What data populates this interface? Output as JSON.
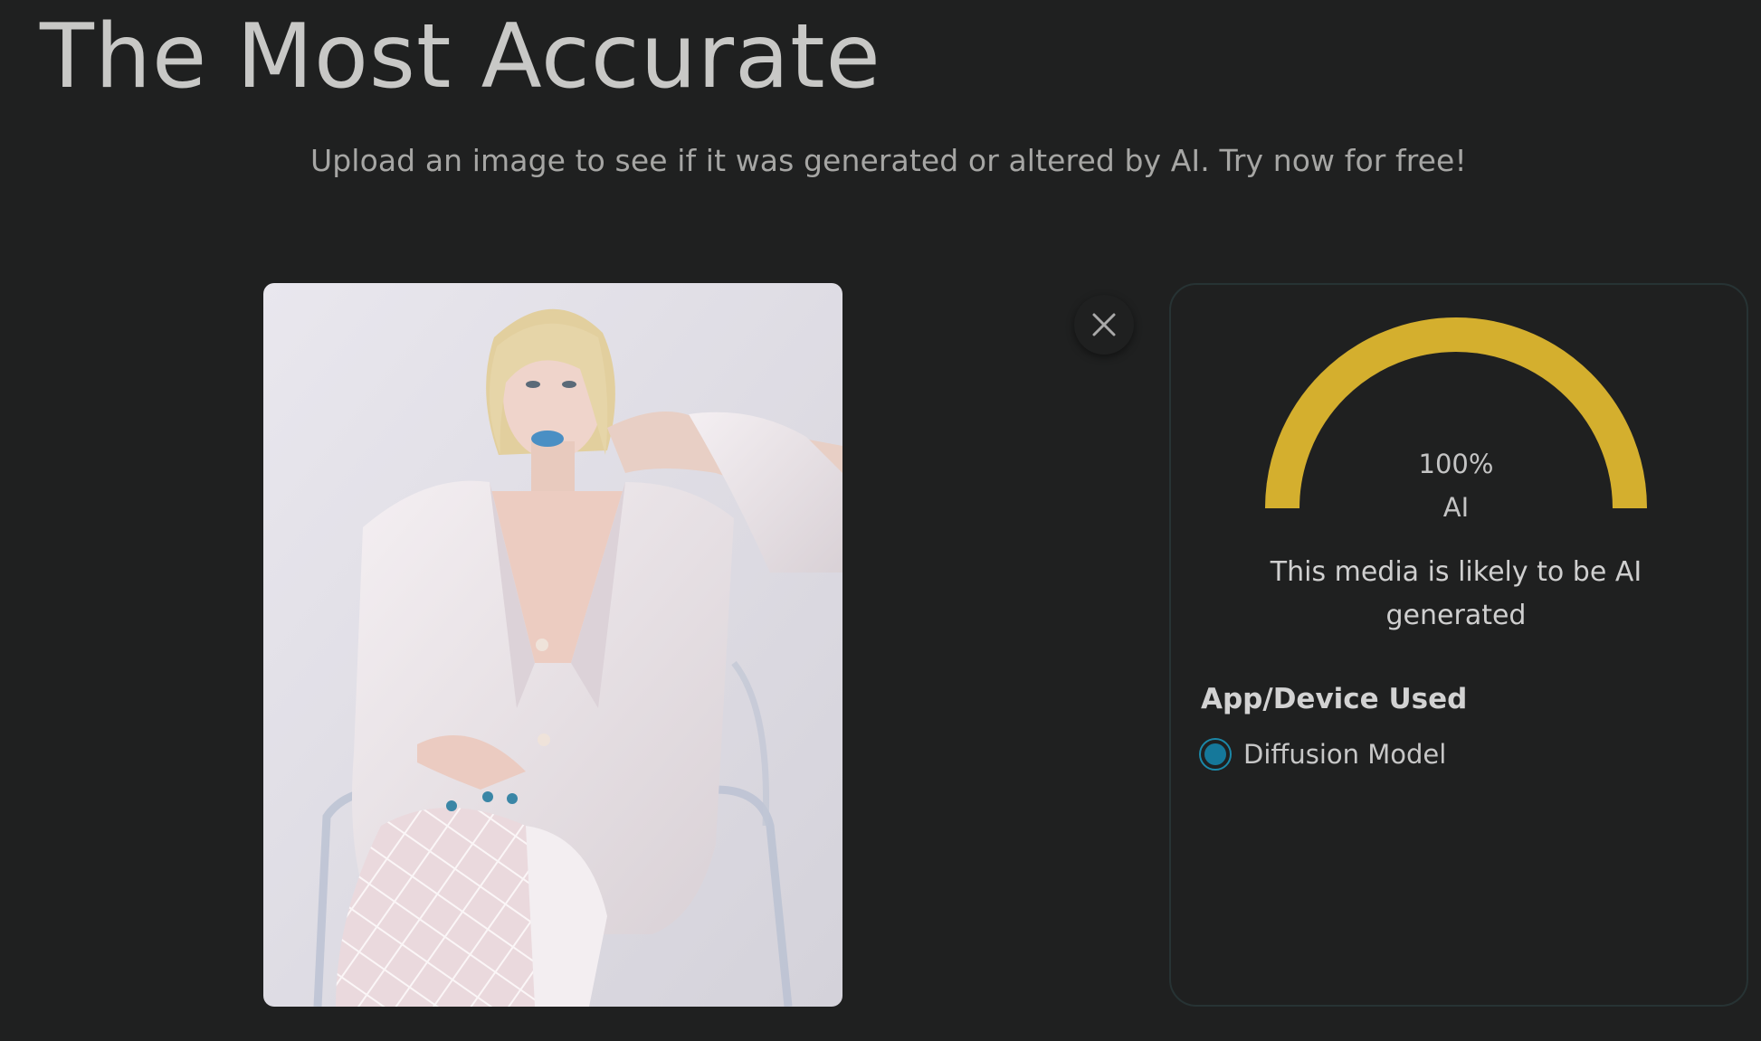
{
  "header": {
    "title": "The Most Accurate",
    "subtitle": "Upload an image to see if it was generated or altered by AI. Try now for free!"
  },
  "upload": {
    "preview_alt": "Uploaded image preview",
    "close_icon": "close-icon"
  },
  "result": {
    "score": "100%",
    "score_label": "AI",
    "score_fraction": 1.0,
    "gauge_color": "#d4af2e",
    "verdict": "This media is likely to be AI generated",
    "app_device_title": "App/Device Used",
    "app_device_options": [
      {
        "label": "Diffusion Model",
        "selected": true
      }
    ],
    "radio_color": "#1b88a8"
  }
}
